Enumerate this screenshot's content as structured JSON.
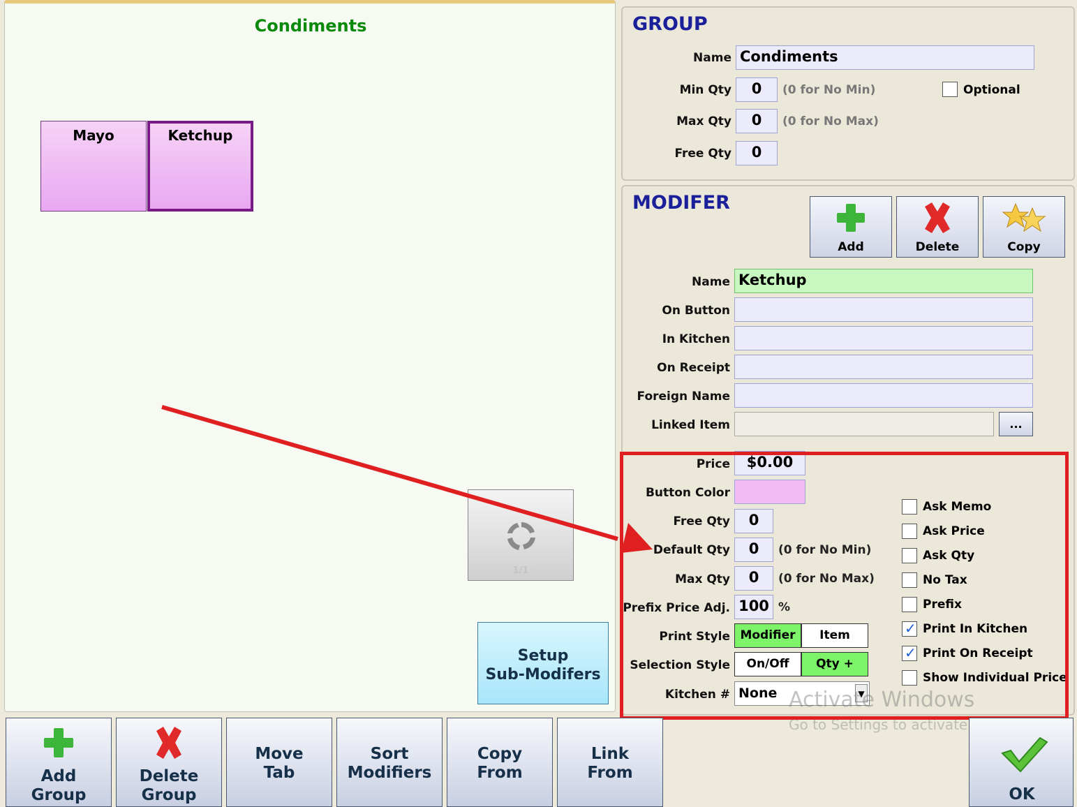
{
  "left": {
    "title": "Condiments",
    "modifiers": [
      {
        "label": "Mayo",
        "selected": false
      },
      {
        "label": "Ketchup",
        "selected": true
      }
    ],
    "paging_label": "1/1",
    "setup_button": {
      "line1": "Setup",
      "line2": "Sub-Modifers"
    }
  },
  "group": {
    "title": "GROUP",
    "name_label": "Name",
    "name_value": "Condiments",
    "min_qty_label": "Min Qty",
    "min_qty_value": "0",
    "min_qty_hint": "(0 for No Min)",
    "optional_label": "Optional",
    "optional_checked": false,
    "max_qty_label": "Max Qty",
    "max_qty_value": "0",
    "max_qty_hint": "(0 for No Max)",
    "free_qty_label": "Free Qty",
    "free_qty_value": "0"
  },
  "modifier": {
    "title": "MODIFER",
    "add_label": "Add",
    "delete_label": "Delete",
    "copy_label": "Copy",
    "name_label": "Name",
    "name_value": "Ketchup",
    "on_button_label": "On Button",
    "on_button_value": "",
    "in_kitchen_label": "In Kitchen",
    "in_kitchen_value": "",
    "on_receipt_label": "On Receipt",
    "on_receipt_value": "",
    "foreign_name_label": "Foreign Name",
    "foreign_name_value": "",
    "linked_item_label": "Linked Item",
    "linked_item_value": "",
    "linked_item_button": "...",
    "price_label": "Price",
    "price_value": "$0.00",
    "button_color_label": "Button Color",
    "button_color": "#f1bdf4",
    "free_qty_label": "Free Qty",
    "free_qty_value": "0",
    "default_qty_label": "Default Qty",
    "default_qty_value": "0",
    "default_qty_hint": "(0 for No Min)",
    "max_qty_label": "Max Qty",
    "max_qty_value": "0",
    "max_qty_hint": "(0 for No Max)",
    "prefix_price_label": "Prefix Price Adj.",
    "prefix_price_value": "100",
    "prefix_price_unit": "%",
    "print_style_label": "Print Style",
    "print_style_options": [
      "Modifier",
      "Item"
    ],
    "print_style_selected": "Modifier",
    "selection_style_label": "Selection Style",
    "selection_style_options": [
      "On/Off",
      "Qty +"
    ],
    "selection_style_selected": "Qty +",
    "kitchen_label": "Kitchen #",
    "kitchen_value": "None",
    "checkboxes": [
      {
        "label": "Ask Memo",
        "checked": false
      },
      {
        "label": "Ask Price",
        "checked": false
      },
      {
        "label": "Ask Qty",
        "checked": false
      },
      {
        "label": "No Tax",
        "checked": false
      },
      {
        "label": "Prefix",
        "checked": false
      },
      {
        "label": "Print In Kitchen",
        "checked": true
      },
      {
        "label": "Print On Receipt",
        "checked": true
      },
      {
        "label": "Show Individual Price",
        "checked": false
      }
    ]
  },
  "toolbar": {
    "add_group": [
      "Add",
      "Group"
    ],
    "delete_group": [
      "Delete",
      "Group"
    ],
    "move_tab": [
      "Move",
      "Tab"
    ],
    "sort_modifiers": [
      "Sort",
      "Modifiers"
    ],
    "copy_from": [
      "Copy",
      "From"
    ],
    "link_from": [
      "Link",
      "From"
    ],
    "ok": "OK"
  },
  "watermark": {
    "line1": "Activate Windows",
    "line2": "Go to Settings to activate Windows."
  },
  "annotation_color": "#e02020"
}
